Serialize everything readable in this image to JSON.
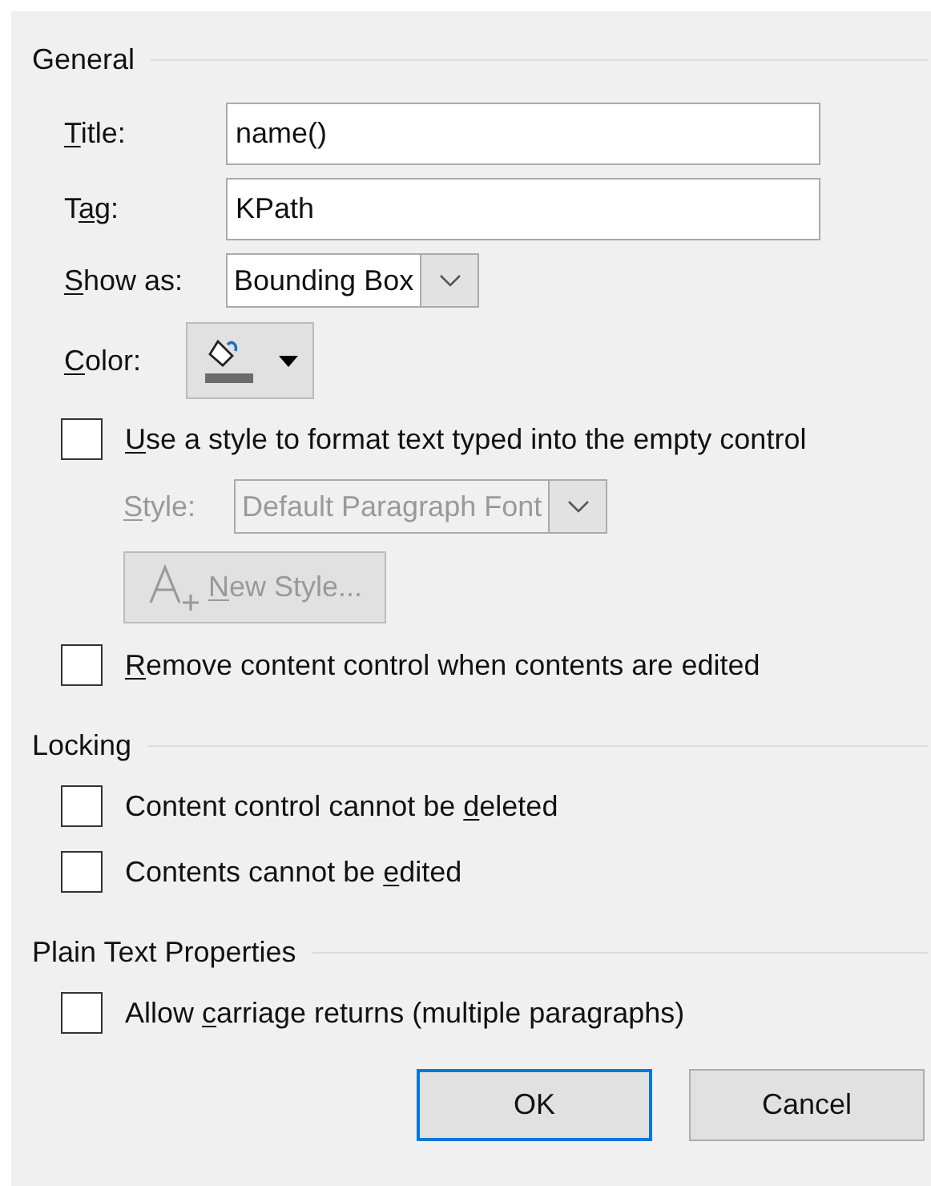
{
  "sections": [
    {
      "heading": "General",
      "kind": "general"
    },
    {
      "heading": "Locking",
      "kind": "checks"
    },
    {
      "heading": "Plain Text Properties",
      "kind": "checks"
    }
  ],
  "general": {
    "title": {
      "label": {
        "key": "T",
        "post": "itle:"
      },
      "value": "name()"
    },
    "tag": {
      "label": {
        "pre": "T",
        "key": "a",
        "post": "g:"
      },
      "value": "KPath"
    },
    "show_as": {
      "label": {
        "key": "S",
        "post": "how as:"
      },
      "value": "Bounding Box"
    },
    "color": {
      "label": {
        "key": "C",
        "post": "olor:"
      }
    },
    "use_style": {
      "label": {
        "key": "U",
        "post": "se a style to format text typed into the empty control"
      },
      "checked": false
    },
    "style": {
      "label": {
        "key": "S",
        "post": "tyle:"
      },
      "value": "Default Paragraph Font",
      "disabled": true
    },
    "new_style": {
      "label": {
        "key": "N",
        "post": "ew Style..."
      },
      "disabled": true
    },
    "remove": {
      "label": {
        "key": "R",
        "post": "emove content control when contents are edited"
      },
      "checked": false
    }
  },
  "locking": [
    {
      "label": {
        "pre": "Content control cannot be ",
        "key": "d",
        "post": "eleted"
      },
      "checked": false
    },
    {
      "label": {
        "pre": "Contents cannot be ",
        "key": "e",
        "post": "dited"
      },
      "checked": false
    }
  ],
  "plain_text": [
    {
      "label": {
        "pre": "Allow ",
        "key": "c",
        "post": "arriage returns (multiple paragraphs)"
      },
      "checked": false
    }
  ],
  "buttons": [
    {
      "label": "OK",
      "default": true
    },
    {
      "label": "Cancel",
      "default": false
    }
  ]
}
